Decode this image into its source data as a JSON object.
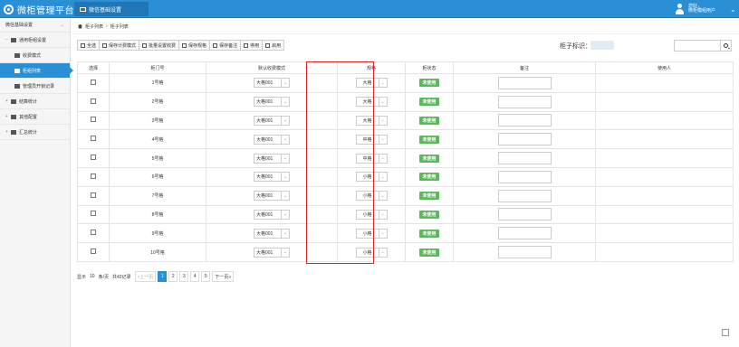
{
  "app": {
    "title": "微柜管理平台",
    "nav_tab": "微信基础设置",
    "user_line1": "您好，",
    "user_line2": "微柜模组用户"
  },
  "sidebar": {
    "header": "微信基础设置",
    "items": [
      {
        "label": "通用柜组设置",
        "level": 1,
        "expand": "−",
        "active": false
      },
      {
        "label": "收费模式",
        "level": 2,
        "active": false
      },
      {
        "label": "柜组列表",
        "level": 2,
        "active": true
      },
      {
        "label": "管理员开锁记录",
        "level": 2,
        "active": false
      },
      {
        "label": "结算统计",
        "level": 1,
        "expand": "+",
        "active": false
      },
      {
        "label": "其他配置",
        "level": 1,
        "expand": "+",
        "active": false
      },
      {
        "label": "汇总统计",
        "level": 1,
        "expand": "+",
        "active": false
      }
    ]
  },
  "breadcrumb": {
    "items": [
      "柜子列表",
      "柜子列表"
    ],
    "separator": "›"
  },
  "toolbar": {
    "buttons": [
      "全选",
      "保存计费模式",
      "批量设置收费",
      "保存规格",
      "保存备注",
      "停用",
      "启用"
    ]
  },
  "filter": {
    "label": "柜子标识：",
    "search_placeholder": ""
  },
  "table": {
    "columns": [
      "选择",
      "柜门号",
      "默认收费模式",
      "规格",
      "柜状态",
      "备注",
      "使用人"
    ],
    "rows": [
      {
        "door": "1号格",
        "mode": "大格001",
        "spec": "大格",
        "status": "未使用"
      },
      {
        "door": "2号格",
        "mode": "大格001",
        "spec": "大格",
        "status": "未使用"
      },
      {
        "door": "3号格",
        "mode": "大格001",
        "spec": "大格",
        "status": "未使用"
      },
      {
        "door": "4号格",
        "mode": "大格001",
        "spec": "中格",
        "status": "未使用"
      },
      {
        "door": "5号格",
        "mode": "大格001",
        "spec": "中格",
        "status": "未使用"
      },
      {
        "door": "6号格",
        "mode": "大格001",
        "spec": "小格",
        "status": "未使用"
      },
      {
        "door": "7号格",
        "mode": "大格001",
        "spec": "小格",
        "status": "未使用"
      },
      {
        "door": "8号格",
        "mode": "大格001",
        "spec": "小格",
        "status": "未使用"
      },
      {
        "door": "9号格",
        "mode": "大格001",
        "spec": "小格",
        "status": "未使用"
      },
      {
        "door": "10号格",
        "mode": "大格001",
        "spec": "小格",
        "status": "未使用"
      }
    ]
  },
  "pager": {
    "show": "显示",
    "size": "10",
    "per": "条/页",
    "total": "共42记录",
    "prev": "«上一页",
    "pages": [
      "1",
      "2",
      "3",
      "4",
      "5"
    ],
    "current": "1",
    "next": "下一页»"
  },
  "colors": {
    "primary": "#2b8fd6",
    "status_green": "#5cb85c",
    "highlight_red": "#e02020"
  }
}
